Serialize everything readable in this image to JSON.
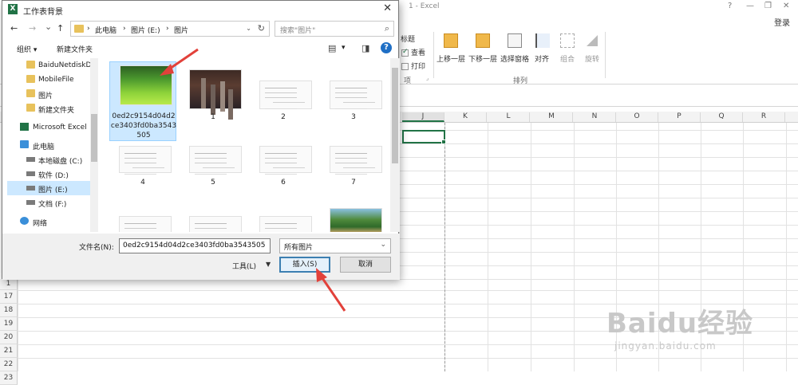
{
  "excel": {
    "title": "1 - Excel",
    "controls": [
      "?",
      "—",
      "❐",
      "✕"
    ],
    "login": "登录",
    "ribbon": {
      "partial_label_1": "标题",
      "partial_check_view": "查看",
      "partial_check_print": "打印",
      "partial_group_label": "项",
      "bring_forward": "上移一层",
      "send_backward": "下移一层",
      "selection_pane": "选择窗格",
      "align": "对齐",
      "group": "组合",
      "rotate": "旋转",
      "arrange_group_label": "排列"
    },
    "columns": [
      "J",
      "K",
      "L",
      "M",
      "N",
      "O",
      "P",
      "Q",
      "R"
    ],
    "rows": [
      "17",
      "18",
      "19",
      "20",
      "21",
      "22",
      "23"
    ],
    "partial_row": "1"
  },
  "watermark": {
    "logo": "Baidu经验",
    "sub": "jingyan.baidu.com"
  },
  "dialog": {
    "title": "工作表背景",
    "close": "✕",
    "nav": {
      "back": "←",
      "forward": "→",
      "dropdown": "⌄",
      "up": "↑",
      "crumbs": [
        "此电脑",
        "图片 (E:)",
        "图片"
      ],
      "crumb_sep": "›",
      "refresh": "↻",
      "search_placeholder": "搜索\"图片\"",
      "search_icon": "⌕"
    },
    "toolbar": {
      "organize": "组织 ▾",
      "new_folder": "新建文件夹",
      "view_dd": "▾",
      "help": "?"
    },
    "navpane": [
      {
        "label": "BaiduNetdiskD",
        "icon": "folder"
      },
      {
        "label": "MobileFile",
        "icon": "folder"
      },
      {
        "label": "图片",
        "icon": "folder"
      },
      {
        "label": "新建文件夹",
        "icon": "folder"
      },
      {
        "label": "Microsoft Excel",
        "icon": "excel"
      },
      {
        "label": "此电脑",
        "icon": "pc"
      },
      {
        "label": "本地磁盘 (C:)",
        "icon": "drive"
      },
      {
        "label": "软件 (D:)",
        "icon": "drive"
      },
      {
        "label": "图片 (E:)",
        "icon": "drive",
        "selected": true
      },
      {
        "label": "文档 (F:)",
        "icon": "drive"
      },
      {
        "label": "网络",
        "icon": "net"
      }
    ],
    "files": [
      {
        "name": "0ed2c9154d04d2ce3403fd0ba3543505",
        "kind": "green",
        "selected": true
      },
      {
        "name": "1",
        "kind": "city"
      },
      {
        "name": "2",
        "kind": "doc"
      },
      {
        "name": "3",
        "kind": "doc"
      },
      {
        "name": "4",
        "kind": "doc"
      },
      {
        "name": "5",
        "kind": "doc"
      },
      {
        "name": "6",
        "kind": "doc"
      },
      {
        "name": "7",
        "kind": "doc"
      },
      {
        "name": "",
        "kind": "doc"
      },
      {
        "name": "",
        "kind": "doc"
      },
      {
        "name": "",
        "kind": "doc"
      },
      {
        "name": "",
        "kind": "park"
      }
    ],
    "filename_label": "文件名(N):",
    "filename_value": "0ed2c9154d04d2ce3403fd0ba3543505",
    "filetype": "所有图片",
    "tools": "工具(L)",
    "insert": "插入(S)",
    "cancel": "取消"
  },
  "colors": {
    "excel_green": "#217346",
    "selection_bg": "#cce8ff",
    "arrow": "#e2413a"
  }
}
